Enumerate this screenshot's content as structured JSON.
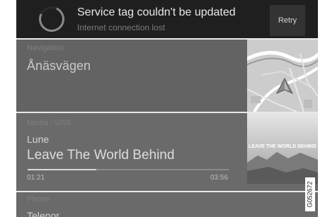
{
  "notification": {
    "title": "Service tag couldn't be updated",
    "subtitle": "Internet connection lost",
    "retry_label": "Retry"
  },
  "navigation": {
    "label": "Navigation",
    "destination": "Ånäsvägen"
  },
  "media": {
    "label": "Media - USB",
    "artist": "Lune",
    "song": "Leave The World Behind",
    "elapsed": "01:21",
    "duration": "03:56",
    "progress_fraction": 0.34,
    "album_art_text": "LEAVE THE WORLD BEHIND"
  },
  "phone": {
    "label": "Phone",
    "operator": "Telenor"
  },
  "image_code": "G052672"
}
